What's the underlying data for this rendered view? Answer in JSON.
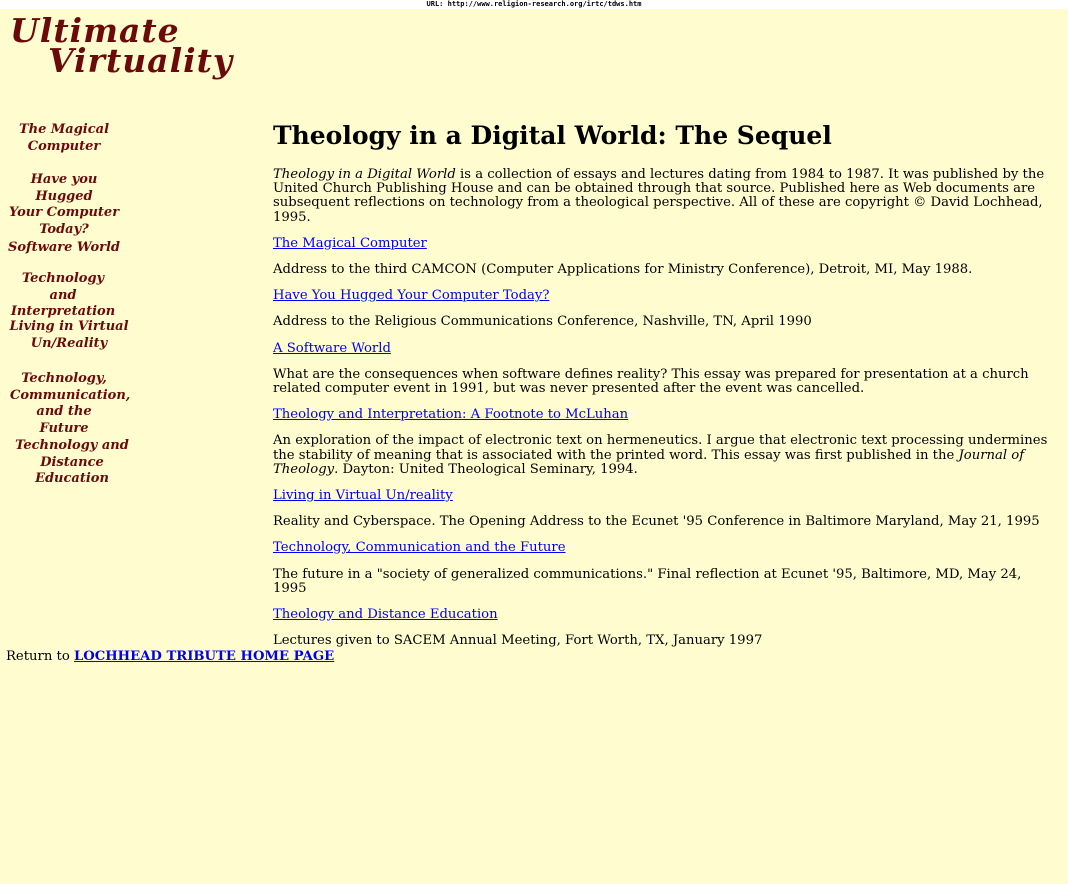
{
  "url_bar": "URL: http://www.religion-research.org/irtc/tdws.htm",
  "logo": {
    "line1": "Ultimate",
    "line2": "Virtuality"
  },
  "nav": [
    {
      "label": "The Magical\nComputer"
    },
    {
      "label": "Have you Hugged\nYour Computer\nToday?"
    },
    {
      "label": "Software World"
    },
    {
      "label": "Technology and\nInterpretation"
    },
    {
      "label": "Living in Virtual\nUn/Reality"
    },
    {
      "label": "Technology,\nCommunication,\nand the Future"
    },
    {
      "label": "Technology and\nDistance Education"
    }
  ],
  "main": {
    "title": "Theology in a Digital World: The Sequel",
    "intro_italic": "Theology in a Digital World",
    "intro_rest": " is a collection of essays and lectures dating from 1984 to 1987. It was published by the United Church Publishing House and can be obtained through that source. Published here as Web documents are subsequent reflections on technology from a theological perspective. All of these are copyright © David Lochhead, 1995.",
    "entries": [
      {
        "link": "The Magical Computer",
        "desc": "Address to the third CAMCON (Computer Applications for Ministry Conference), Detroit, MI, May 1988."
      },
      {
        "link": "Have You Hugged Your Computer Today?",
        "desc": "Address to the Religious Communications Conference, Nashville, TN, April 1990"
      },
      {
        "link": "A Software World",
        "desc": "What are the consequences when software defines reality? This essay was prepared for presentation at a church related computer event in 1991, but was never presented after the event was cancelled."
      },
      {
        "link": "Theology and Interpretation: A Footnote to McLuhan",
        "desc_pre": "An exploration of the impact of electronic text on hermeneutics. I argue that electronic text processing undermines the stability of meaning that is associated with the printed word. This essay was first published in the ",
        "desc_italic": "Journal of Theology",
        "desc_post": ". Dayton: United Theological Seminary, 1994."
      },
      {
        "link": "Living in Virtual Un/reality",
        "desc": "Reality and Cyberspace. The Opening Address to the Ecunet '95 Conference in Baltimore Maryland, May 21, 1995"
      },
      {
        "link": "Technology, Communication and the Future",
        "desc": "The future in a \"society of generalized communications.\" Final reflection at Ecunet '95, Baltimore, MD, May 24, 1995"
      },
      {
        "link": "Theology and Distance Education",
        "desc": "Lectures given to SACEM Annual Meeting, Fort Worth, TX, January 1997"
      }
    ]
  },
  "footer": {
    "return_text": "Return to ",
    "return_link": "LOCHHEAD TRIBUTE HOME PAGE"
  }
}
